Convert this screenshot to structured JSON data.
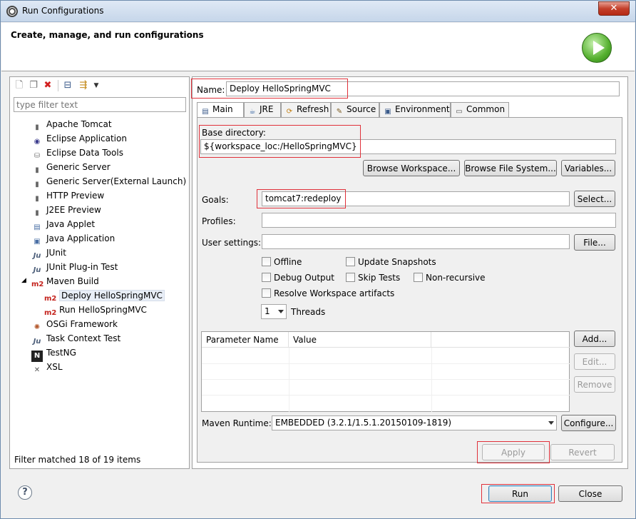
{
  "window": {
    "title": "Run Configurations",
    "close_glyph": "✕"
  },
  "header": {
    "title": "Create, manage, and run configurations"
  },
  "left": {
    "filter_placeholder": "type filter text",
    "items": [
      {
        "label": "Apache Tomcat",
        "icon": "tomcat-icon"
      },
      {
        "label": "Eclipse Application",
        "icon": "eclipse-icon"
      },
      {
        "label": "Eclipse Data Tools",
        "icon": "database-icon"
      },
      {
        "label": "Generic Server",
        "icon": "server-icon"
      },
      {
        "label": "Generic Server(External Launch)",
        "icon": "server-icon"
      },
      {
        "label": "HTTP Preview",
        "icon": "server-icon"
      },
      {
        "label": "J2EE Preview",
        "icon": "server-icon"
      },
      {
        "label": "Java Applet",
        "icon": "applet-icon"
      },
      {
        "label": "Java Application",
        "icon": "java-app-icon"
      },
      {
        "label": "JUnit",
        "icon": "junit-icon"
      },
      {
        "label": "JUnit Plug-in Test",
        "icon": "junit-plugin-icon"
      },
      {
        "label": "Maven Build",
        "icon": "m2-icon"
      },
      {
        "label": "Deploy HelloSpringMVC",
        "icon": "m2-icon"
      },
      {
        "label": "Run HelloSpringMVC",
        "icon": "m2-icon"
      },
      {
        "label": "OSGi Framework",
        "icon": "osgi-icon"
      },
      {
        "label": "Task Context Test",
        "icon": "junit-icon"
      },
      {
        "label": "TestNG",
        "icon": "testng-icon"
      },
      {
        "label": "XSL",
        "icon": "xsl-icon"
      }
    ],
    "status": "Filter matched 18 of 19 items"
  },
  "right": {
    "name_label": "Name:",
    "name_value": "Deploy HelloSpringMVC",
    "tabs": [
      "Main",
      "JRE",
      "Refresh",
      "Source",
      "Environment",
      "Common"
    ],
    "base_dir_label": "Base directory:",
    "base_dir_value": "${workspace_loc:/HelloSpringMVC}",
    "browse_workspace": "Browse Workspace...",
    "browse_fs": "Browse File System...",
    "variables": "Variables...",
    "goals_label": "Goals:",
    "goals_value": "tomcat7:redeploy",
    "select_btn": "Select...",
    "profiles_label": "Profiles:",
    "user_settings_label": "User settings:",
    "file_btn": "File...",
    "checks": {
      "offline": "Offline",
      "update_snapshots": "Update Snapshots",
      "debug_output": "Debug Output",
      "skip_tests": "Skip Tests",
      "non_recursive": "Non-recursive",
      "resolve_ws": "Resolve Workspace artifacts"
    },
    "threads_value": "1",
    "threads_label": "Threads",
    "param_cols": [
      "Parameter Name",
      "Value"
    ],
    "add_btn": "Add...",
    "edit_btn": "Edit...",
    "remove_btn": "Remove",
    "runtime_label": "Maven Runtime:",
    "runtime_value": "EMBEDDED (3.2.1/1.5.1.20150109-1819)",
    "configure_btn": "Configure...",
    "apply_btn": "Apply",
    "revert_btn": "Revert"
  },
  "footer": {
    "help": "?",
    "run": "Run",
    "close": "Close"
  }
}
